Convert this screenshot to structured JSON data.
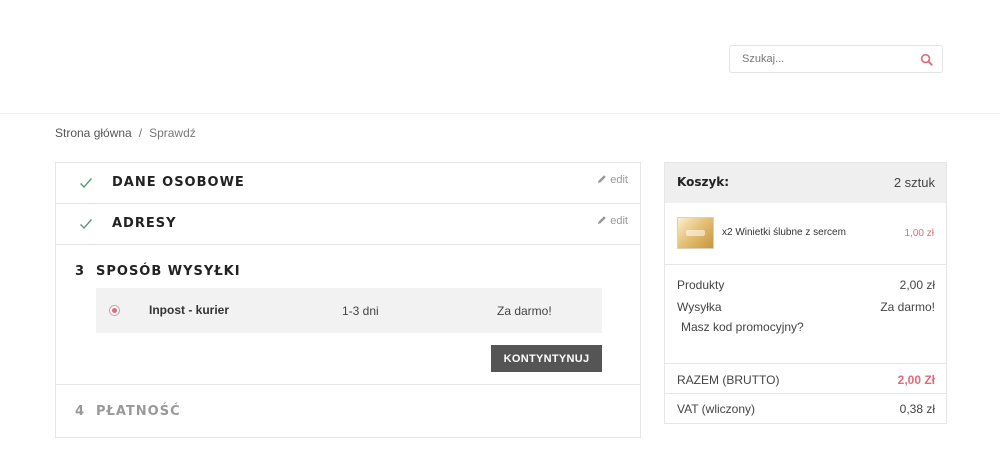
{
  "search": {
    "placeholder": "Szukaj..."
  },
  "breadcrumb": {
    "home": "Strona główna",
    "separator": "/",
    "current": "Sprawdź"
  },
  "checkout": {
    "edit_label": "edit",
    "steps": [
      {
        "title": "Dane osobowe",
        "status": "done"
      },
      {
        "title": "Adresy",
        "status": "done"
      },
      {
        "number": "3",
        "title": "Sposób wysyłki",
        "status": "current"
      },
      {
        "number": "4",
        "title": "Płatność",
        "status": "pending"
      }
    ],
    "carrier": {
      "name": "Inpost - kurier",
      "delivery_time": "1-3 dni",
      "price": "Za darmo!",
      "selected": true
    },
    "continue_label": "Kontyntynuj"
  },
  "cart": {
    "title": "Koszyk:",
    "count": "2 sztuk",
    "items": [
      {
        "name": "x2 Winietki ślubne z sercem",
        "price": "1,00 zł"
      }
    ],
    "subtotal": {
      "label": "Produkty",
      "value": "2,00 zł"
    },
    "shipping": {
      "label": "Wysyłka",
      "value": "Za darmo!"
    },
    "promo_label": "Masz kod promocyjny?",
    "total": {
      "label": "RAZEM (BRUTTO)",
      "value": "2,00 Zł"
    },
    "vat": {
      "label": "VAT (wliczony)",
      "value": "0,38 zł"
    }
  },
  "colors": {
    "accent": "#e26a7a",
    "button": "#555555",
    "panel_header": "#efefef",
    "check": "#5a9a7a"
  }
}
